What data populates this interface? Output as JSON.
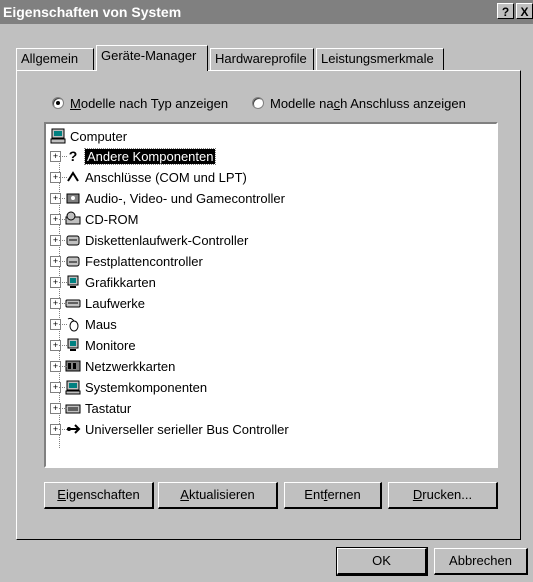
{
  "window": {
    "title": "Eigenschaften von System",
    "help_label": "?",
    "close_label": "X"
  },
  "tabs": [
    {
      "label": "Allgemein"
    },
    {
      "label": "Geräte-Manager",
      "active": true
    },
    {
      "label": "Hardwareprofile"
    },
    {
      "label": "Leistungsmerkmale"
    }
  ],
  "view_options": {
    "by_type": {
      "pre": "M",
      "rest": "odelle nach Typ anzeigen",
      "checked": true
    },
    "by_connection": {
      "pre": "Modelle na",
      "u": "c",
      "rest": "h Anschluss anzeigen",
      "checked": false
    }
  },
  "tree": {
    "root": "Computer",
    "items": [
      {
        "label": "Andere Komponenten",
        "icon": "question-device-icon",
        "selected": true
      },
      {
        "label": "Anschlüsse (COM und LPT)",
        "icon": "port-connector-icon"
      },
      {
        "label": "Audio-, Video- und Gamecontroller",
        "icon": "sound-video-icon"
      },
      {
        "label": "CD-ROM",
        "icon": "cdrom-icon"
      },
      {
        "label": "Diskettenlaufwerk-Controller",
        "icon": "floppy-controller-icon"
      },
      {
        "label": "Festplattencontroller",
        "icon": "hard-disk-controller-icon"
      },
      {
        "label": "Grafikkarten",
        "icon": "display-adapter-icon"
      },
      {
        "label": "Laufwerke",
        "icon": "disk-drive-icon"
      },
      {
        "label": "Maus",
        "icon": "mouse-icon"
      },
      {
        "label": "Monitore",
        "icon": "monitor-icon"
      },
      {
        "label": "Netzwerkkarten",
        "icon": "network-card-icon"
      },
      {
        "label": "Systemkomponenten",
        "icon": "system-device-icon"
      },
      {
        "label": "Tastatur",
        "icon": "keyboard-icon"
      },
      {
        "label": "Universeller serieller Bus Controller",
        "icon": "usb-icon"
      }
    ]
  },
  "actions": {
    "properties": {
      "u": "E",
      "rest": "igenschaften"
    },
    "refresh": {
      "u": "A",
      "rest": "ktualisieren"
    },
    "remove": {
      "pre": "Ent",
      "u": "f",
      "rest": "ernen"
    },
    "print": {
      "u": "D",
      "rest": "rucken..."
    }
  },
  "dialog": {
    "ok": "OK",
    "cancel": "Abbrechen"
  }
}
